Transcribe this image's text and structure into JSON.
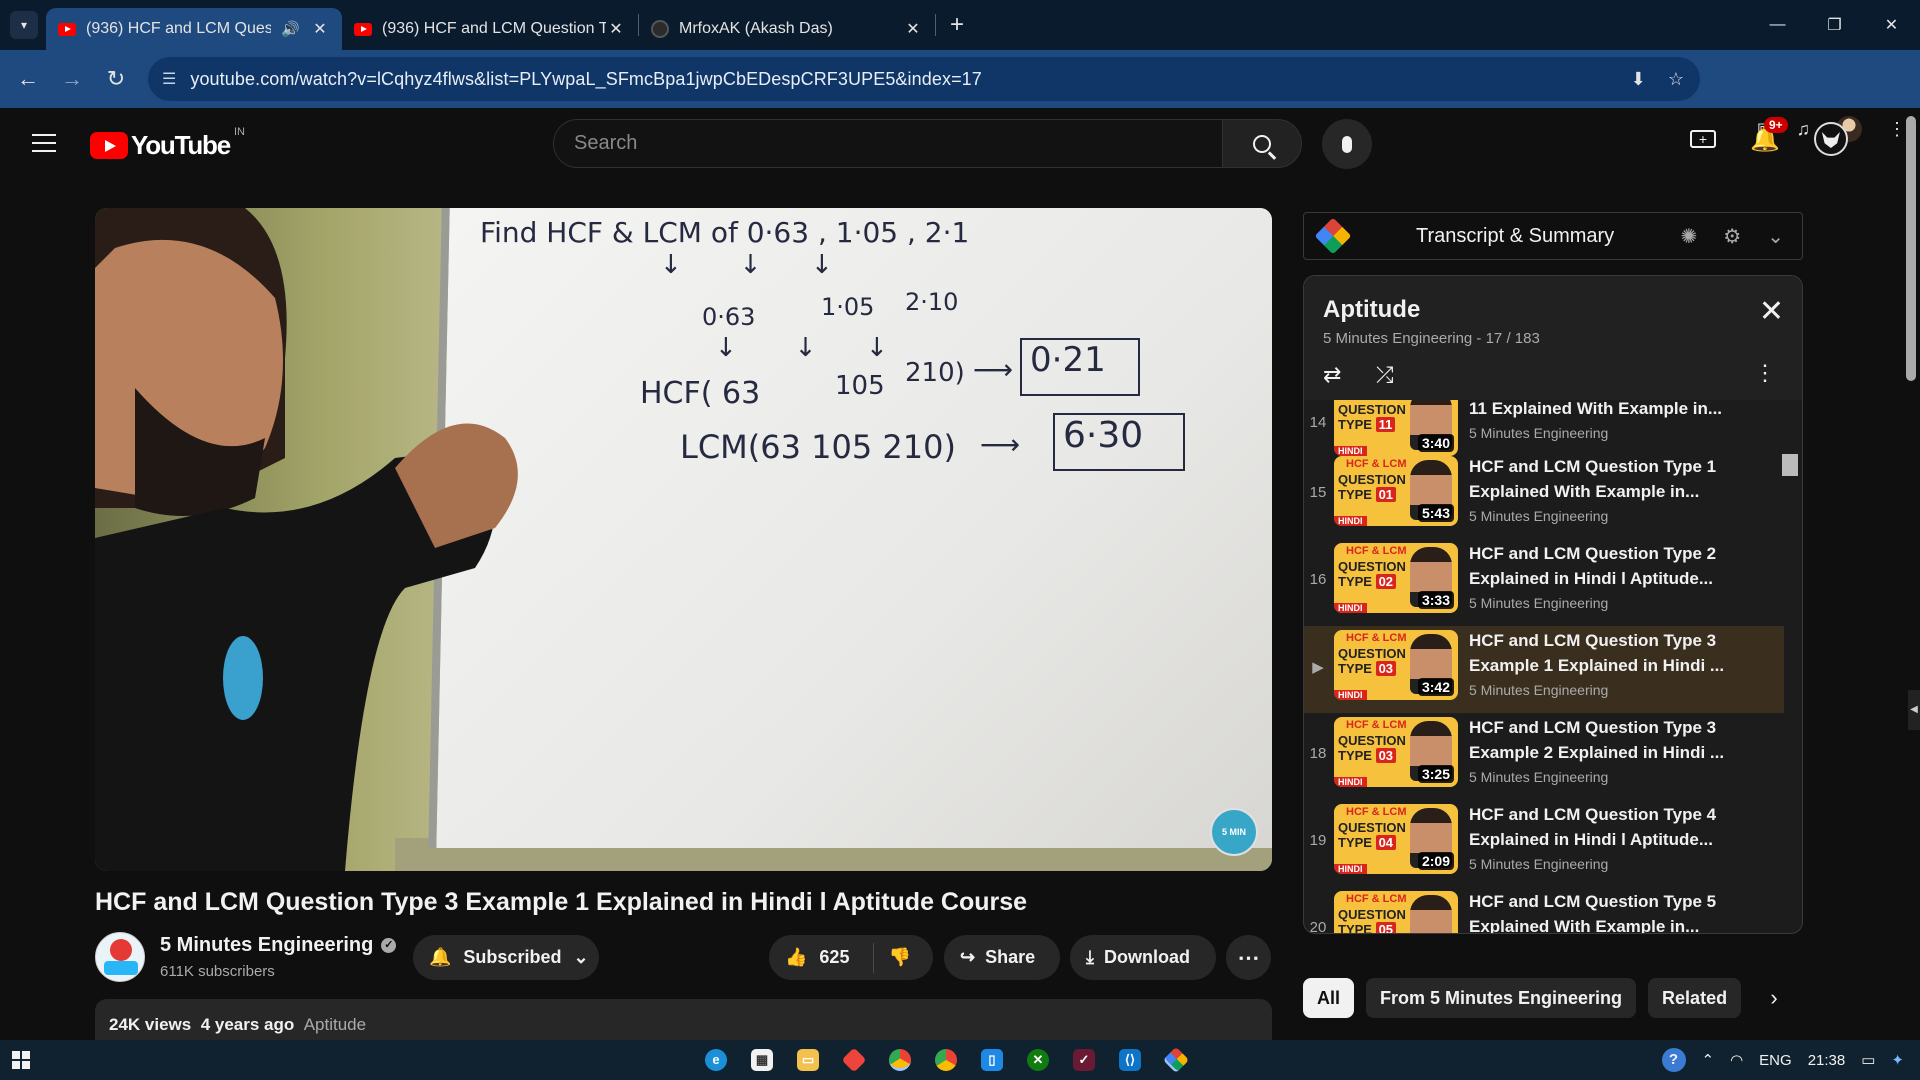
{
  "browser": {
    "tabs": [
      {
        "title": "(936) HCF and LCM Questio",
        "type": "youtube",
        "audio": true,
        "active": true
      },
      {
        "title": "(936) HCF and LCM Question Ty",
        "type": "youtube",
        "audio": false,
        "active": false
      },
      {
        "title": "MrfoxAK (Akash Das)",
        "type": "github",
        "audio": false,
        "active": false
      }
    ],
    "url": "youtube.com/watch?v=lCqhyz4flws&list=PLYwpaL_SFmcBpa1jwpCbEDespCRF3UPE5&index=17"
  },
  "header": {
    "logo_text": "YouTube",
    "country": "IN",
    "search_placeholder": "Search",
    "notifications": "9+"
  },
  "video": {
    "board": {
      "line1": "Find HCF & LCM of 0·63 , 1·05 , 2·1",
      "row2": [
        "0·63",
        "1·05",
        "2·10"
      ],
      "hcf_left": "HCF( 63",
      "hcf_mid": "105",
      "hcf_right": "210)",
      "hcf_result": "0·21",
      "lcm_left": "LCM(63  105  210)",
      "lcm_result": "6·30"
    },
    "title": "HCF and LCM Question Type 3 Example 1 Explained in Hindi l Aptitude Course",
    "channel": "5 Minutes Engineering",
    "subscribers": "611K subscribers",
    "subscribe_label": "Subscribed",
    "likes": "625",
    "share_label": "Share",
    "download_label": "Download",
    "views": "24K views",
    "age": "4 years ago",
    "tag": "Aptitude"
  },
  "extension": {
    "title": "Transcript & Summary"
  },
  "playlist": {
    "title": "Aptitude",
    "subtitle": "5 Minutes Engineering - 17 / 183",
    "items": [
      {
        "num": "14",
        "type": "11",
        "duration": "3:40",
        "title": "11 Explained With Example in...",
        "channel": "5 Minutes Engineering"
      },
      {
        "num": "15",
        "type": "01",
        "duration": "5:43",
        "title": "HCF and LCM Question Type 1 Explained With Example in...",
        "channel": "5 Minutes Engineering"
      },
      {
        "num": "16",
        "type": "02",
        "duration": "3:33",
        "title": "HCF and LCM Question Type 2 Explained in Hindi l Aptitude...",
        "channel": "5 Minutes Engineering"
      },
      {
        "num": "▶",
        "type": "03",
        "duration": "3:42",
        "title": "HCF and LCM Question Type 3 Example 1 Explained in Hindi ...",
        "channel": "5 Minutes Engineering"
      },
      {
        "num": "18",
        "type": "03",
        "duration": "3:25",
        "title": "HCF and LCM Question Type 3 Example 2 Explained in Hindi ...",
        "channel": "5 Minutes Engineering"
      },
      {
        "num": "19",
        "type": "04",
        "duration": "2:09",
        "title": "HCF and LCM Question Type 4 Explained in Hindi l Aptitude...",
        "channel": "5 Minutes Engineering"
      },
      {
        "num": "20",
        "type": "05",
        "duration": "",
        "title": "HCF and LCM Question Type 5 Explained With Example in...",
        "channel": ""
      }
    ]
  },
  "chips": [
    "All",
    "From 5 Minutes Engineering",
    "Related"
  ],
  "taskbar": {
    "lang": "ENG",
    "time": "21:38"
  }
}
